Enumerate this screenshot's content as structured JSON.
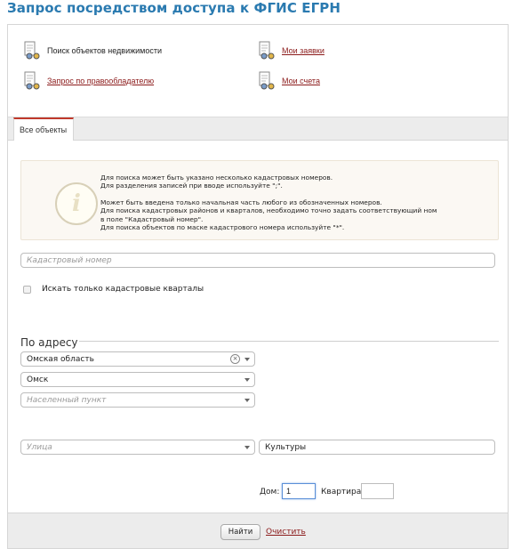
{
  "page": {
    "title": "Запрос посредством доступа к ФГИС ЕГРН"
  },
  "menu": {
    "search_objects": "Поиск объектов недвижимости",
    "my_requests": "Мои заявки",
    "owner_request": "Запрос по правообладателю",
    "my_accounts": "Мои счета"
  },
  "tabs": {
    "all_objects": "Все объекты"
  },
  "info": {
    "lines": [
      "Для поиска может быть указано несколько кадастровых номеров.",
      "Для разделения записей при вводе используйте \";\".",
      "",
      "Может быть введена только начальная часть любого из обозначенных номеров.",
      "Для поиска кадастровых районов и кварталов, необходимо точно задать соответствующий ном",
      "в поле \"Кадастровый номер\".",
      "Для поиска объектов по маске кадастрового номера используйте \"*\"."
    ],
    "icon": "info-icon"
  },
  "cadastral": {
    "placeholder": "Кадастровый номер",
    "value": ""
  },
  "checkbox": {
    "label": "Искать только кадастровые кварталы",
    "checked": false
  },
  "address": {
    "section_title": "По адресу",
    "region": "Омская область",
    "city": "Омск",
    "settlement_placeholder": "Населенный пункт",
    "street_placeholder": "Улица",
    "street_value": "Культуры",
    "house_label": "Дом:",
    "house_value": "1",
    "apt_label": "Квартира:",
    "apt_value": ""
  },
  "footer": {
    "find_label": "Найти",
    "clear_label": "Очистить"
  },
  "colors": {
    "title": "#2a7ab0",
    "link": "#8b1a1a",
    "tab_accent": "#c0392b"
  }
}
